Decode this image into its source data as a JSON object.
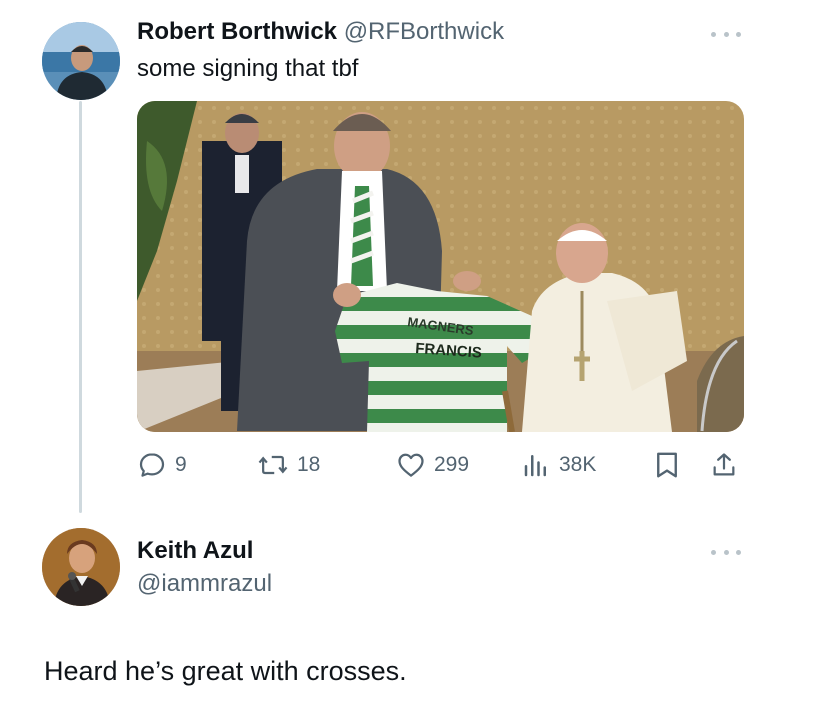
{
  "tweet": {
    "author_name": "Robert Borthwick",
    "author_handle": "@RFBorthwick",
    "text": "some signing that tbf",
    "media": {
      "shirt_sponsor": "MAGNERS",
      "shirt_name": "FRANCIS"
    },
    "actions": {
      "replies": "9",
      "retweets": "18",
      "likes": "299",
      "views": "38K"
    }
  },
  "reply": {
    "author_name": "Keith Azul",
    "author_handle": "@iammrazul",
    "text": "Heard he’s great with crosses."
  },
  "icons": {
    "reply": "reply-icon",
    "retweet": "retweet-icon",
    "like": "heart-icon",
    "views": "views-icon",
    "bookmark": "bookmark-icon",
    "share": "share-icon",
    "more": "more-icon"
  },
  "colors": {
    "text_primary": "#0f1419",
    "text_secondary": "#536471",
    "thread_line": "#cfd9de"
  }
}
